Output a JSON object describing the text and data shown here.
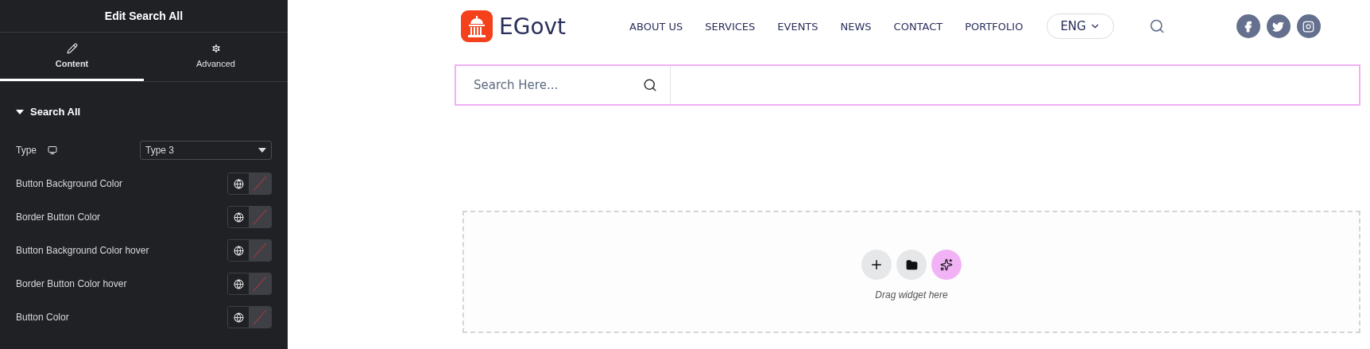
{
  "panel": {
    "title": "Edit Search All",
    "tabs": [
      {
        "label": "Content",
        "selected": true
      },
      {
        "label": "Advanced",
        "selected": false
      }
    ],
    "section": {
      "title": "Search All",
      "expanded": true
    },
    "controls": [
      {
        "kind": "select",
        "label": "Type",
        "value": "Type 3"
      },
      {
        "kind": "color",
        "label": "Button Background Color"
      },
      {
        "kind": "color",
        "label": "Border Button Color"
      },
      {
        "kind": "color",
        "label": "Button Background Color hover"
      },
      {
        "kind": "color",
        "label": "Border Button Color hover"
      },
      {
        "kind": "color",
        "label": "Button Color"
      }
    ]
  },
  "site": {
    "logo": "EGovt",
    "nav": [
      "ABOUT US",
      "SERVICES",
      "EVENTS",
      "NEWS",
      "CONTACT",
      "PORTFOLIO"
    ],
    "language": "ENG",
    "search": {
      "placeholder": "Search Here..."
    },
    "dropzone": {
      "hint": "Drag widget here"
    }
  }
}
